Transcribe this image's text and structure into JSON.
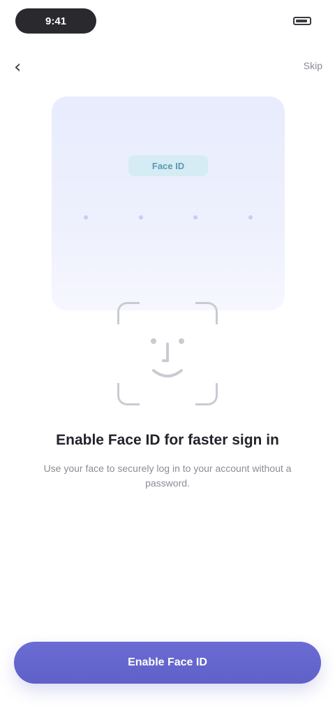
{
  "status_bar": {
    "time": "9:41",
    "battery_icon": "battery-icon"
  },
  "nav": {
    "back_icon": "chevron-left-icon",
    "back_glyph": "‹",
    "skip_label": "Skip"
  },
  "hero": {
    "badge_text": "Face ID"
  },
  "face_id": {
    "icon": "face-id-icon"
  },
  "content": {
    "title": "Enable Face ID for faster sign in",
    "subtitle": "Use your face to securely log in to your account without a password."
  },
  "primary_button": {
    "label": "Enable Face ID"
  },
  "colors": {
    "accent": "#6163C9",
    "card_background": "#E9ECFD",
    "badge_background": "#D5ECF5",
    "frame": "#C9CBD3"
  }
}
